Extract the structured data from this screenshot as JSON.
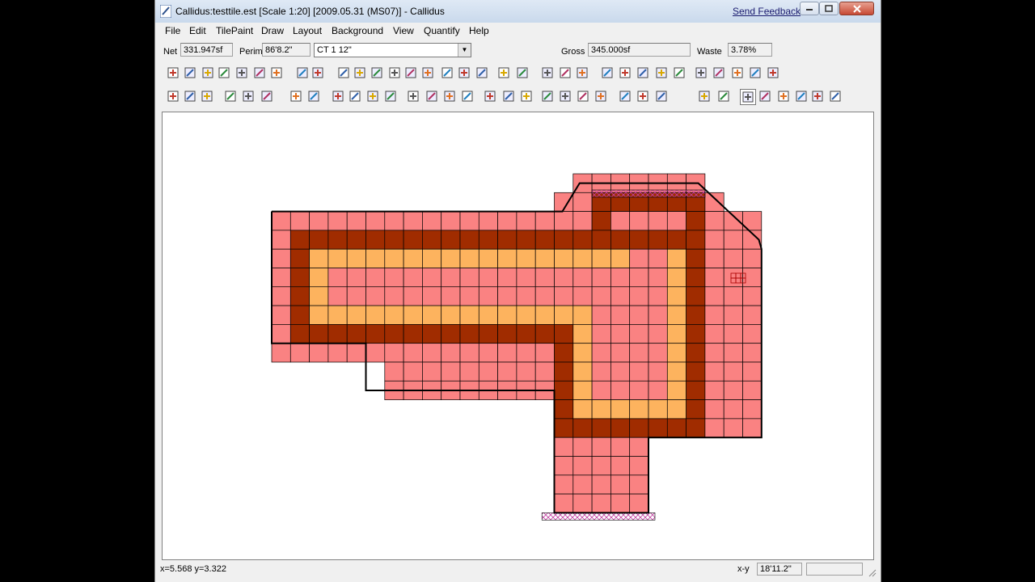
{
  "window": {
    "title": "Callidus:testtile.est  [Scale 1:20]  [2009.05.31 (MS07)] - Callidus",
    "send_feedback": "Send Feedback"
  },
  "menu": [
    "File",
    "Edit",
    "TilePaint",
    "Draw",
    "Layout",
    "Background",
    "View",
    "Quantify",
    "Help"
  ],
  "stats": {
    "net_label": "Net",
    "net_value": "331.947sf",
    "perim_label": "Perim",
    "perim_value": "86'8.2\"",
    "tile_selected": "CT 1 12\"",
    "gross_label": "Gross",
    "gross_value": "345.000sf",
    "waste_label": "Waste",
    "waste_value": "3.78%"
  },
  "toolbar1": [
    "draw-wall-icon",
    "door-icon",
    "undo-arc-icon",
    "circle-icon",
    "eraser-icon",
    "text-icon",
    "pencil-icon",
    "rectangle-icon",
    "numbering-icon",
    "fill-region-icon",
    "move-icon",
    "rotate-icon",
    "copy-region-icon",
    "angle-icon",
    "arc-icon",
    "mirror-icon",
    "merge-icon",
    "grid-select-icon",
    "snap-off-icon",
    "snap-angle-icon",
    "cut-region-icon",
    "trim-icon",
    "join-icon",
    "split-icon",
    "group-icon",
    "ungroup-icon",
    "combine-icon",
    "align-icon",
    "distribute-icon",
    "layer-up-icon",
    "layer-down-icon",
    "delete-region-icon",
    "flip-icon",
    "spacer-icon"
  ],
  "toolbar2": [
    "new-file-icon",
    "open-folder-icon",
    "save-icon",
    "print-icon",
    "print-preview-icon",
    "pdf-icon",
    "undo-icon",
    "redo-icon",
    "layer-icon",
    "palette-icon",
    "color-icon",
    "tile-library-icon",
    "house-icon",
    "room-icon",
    "copy-room-icon",
    "paste-icon",
    "region-icon",
    "region-copy-icon",
    "zoom-icon",
    "play-icon",
    "play-mark-icon",
    "play-down-icon",
    "sum-icon",
    "web-icon",
    "settings-icon",
    "help-icon",
    "paint-bucket-icon",
    "brush-icon",
    "select-tool-icon",
    "rectangle-tool-icon",
    "line-tool-icon",
    "stamp-icon",
    "refresh-icon",
    "eraser-tool-icon"
  ],
  "colors": {
    "tile_pink": "#fa8282",
    "tile_dark": "#a02c00",
    "tile_orange": "#fdb35e",
    "cut_hatch": "#c040a0",
    "grid_line": "#000000"
  },
  "status": {
    "coords": "x=5.568 y=3.322",
    "xy_label": "x-y",
    "xy_value": "18'11.2\""
  }
}
